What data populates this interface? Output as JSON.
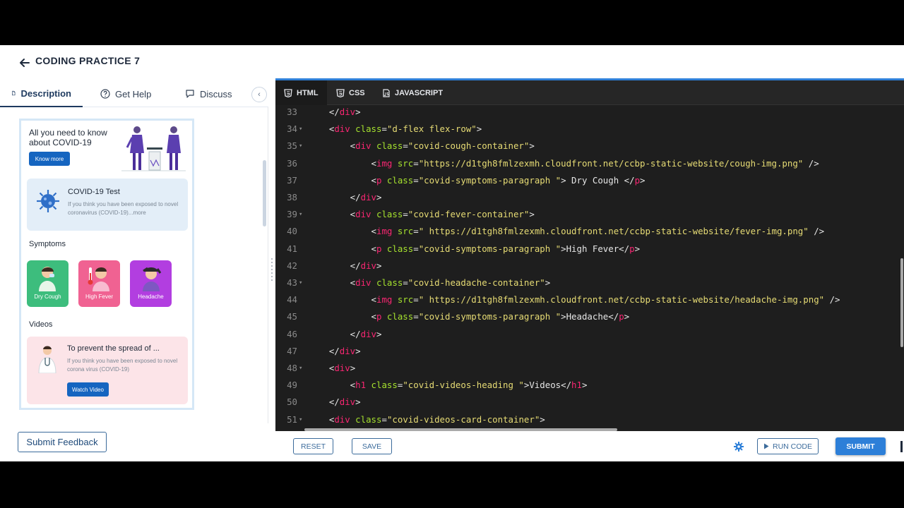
{
  "header": {
    "title": "CODING PRACTICE 7"
  },
  "left_tabs": [
    {
      "label": "Description",
      "icon": "document-icon"
    },
    {
      "label": "Get Help",
      "icon": "question-circle-icon"
    },
    {
      "label": "Discuss",
      "icon": "chat-icon"
    }
  ],
  "preview": {
    "hero_title": "All you need to know about COVID-19",
    "know_more": "Know more",
    "test_title": "COVID-19 Test",
    "test_desc": "If you think you have been exposed to novel coronavirus (COVID-19)...more",
    "symptoms_heading": "Symptoms",
    "symptoms": [
      "Dry Cough",
      "High Fever",
      "Headache"
    ],
    "videos_heading": "Videos",
    "video_title": "To prevent the spread of ...",
    "video_desc": "If you think you have been exposed to novel corona virus (COVID-19)",
    "watch_video": "Watch Video"
  },
  "feedback_label": "Submit Feedback",
  "editor_tabs": [
    {
      "label": "HTML",
      "icon": "html5-icon"
    },
    {
      "label": "CSS",
      "icon": "css3-icon"
    },
    {
      "label": "JAVASCRIPT",
      "icon": "js-file-icon"
    }
  ],
  "code_lines": [
    {
      "n": "33",
      "fold": false,
      "html": "    &lt;/<span class='tg'>div</span>&gt;"
    },
    {
      "n": "34",
      "fold": true,
      "html": "    &lt;<span class='tg'>div</span> <span class='at'>class</span>=<span class='st'>\"d-flex flex-row\"</span>&gt;"
    },
    {
      "n": "35",
      "fold": true,
      "html": "        &lt;<span class='tg'>div</span> <span class='at'>class</span>=<span class='st'>\"covid-cough-container\"</span>&gt;"
    },
    {
      "n": "36",
      "fold": false,
      "html": "            &lt;<span class='tg'>img</span> <span class='at'>src</span>=<span class='st'>\"https://d1tgh8fmlzexmh.cloudfront.net/ccbp-static-website/cough-img.png\"</span> /&gt;"
    },
    {
      "n": "37",
      "fold": false,
      "html": "            &lt;<span class='tg'>p</span> <span class='at'>class</span>=<span class='st'>\"covid-symptoms-paragraph \"</span>&gt; Dry Cough &lt;/<span class='tg'>p</span>&gt;"
    },
    {
      "n": "38",
      "fold": false,
      "html": "        &lt;/<span class='tg'>div</span>&gt;"
    },
    {
      "n": "39",
      "fold": true,
      "html": "        &lt;<span class='tg'>div</span> <span class='at'>class</span>=<span class='st'>\"covid-fever-container\"</span>&gt;"
    },
    {
      "n": "40",
      "fold": false,
      "html": "            &lt;<span class='tg'>img</span> <span class='at'>src</span>=<span class='st'>\" https://d1tgh8fmlzexmh.cloudfront.net/ccbp-static-website/fever-img.png\"</span> /&gt;"
    },
    {
      "n": "41",
      "fold": false,
      "html": "            &lt;<span class='tg'>p</span> <span class='at'>class</span>=<span class='st'>\"covid-symptoms-paragraph \"</span>&gt;High Fever&lt;/<span class='tg'>p</span>&gt;"
    },
    {
      "n": "42",
      "fold": false,
      "html": "        &lt;/<span class='tg'>div</span>&gt;"
    },
    {
      "n": "43",
      "fold": true,
      "html": "        &lt;<span class='tg'>div</span> <span class='at'>class</span>=<span class='st'>\"covid-headache-container\"</span>&gt;"
    },
    {
      "n": "44",
      "fold": false,
      "html": "            &lt;<span class='tg'>img</span> <span class='at'>src</span>=<span class='st'>\" https://d1tgh8fmlzexmh.cloudfront.net/ccbp-static-website/headache-img.png\"</span> /&gt;"
    },
    {
      "n": "45",
      "fold": false,
      "html": "            &lt;<span class='tg'>p</span> <span class='at'>class</span>=<span class='st'>\"covid-symptoms-paragraph \"</span>&gt;Headache&lt;/<span class='tg'>p</span>&gt;"
    },
    {
      "n": "46",
      "fold": false,
      "html": "        &lt;/<span class='tg'>div</span>&gt;"
    },
    {
      "n": "47",
      "fold": false,
      "html": "    &lt;/<span class='tg'>div</span>&gt;"
    },
    {
      "n": "48",
      "fold": true,
      "html": "    &lt;<span class='tg'>div</span>&gt;"
    },
    {
      "n": "49",
      "fold": false,
      "html": "        &lt;<span class='tg'>h1</span> <span class='at'>class</span>=<span class='st'>\"covid-videos-heading \"</span>&gt;Videos&lt;/<span class='tg'>h1</span>&gt;"
    },
    {
      "n": "50",
      "fold": false,
      "html": "    &lt;/<span class='tg'>div</span>&gt;"
    },
    {
      "n": "51",
      "fold": true,
      "html": "    &lt;<span class='tg'>div</span> <span class='at'>class</span>=<span class='st'>\"covid-videos-card-container\"</span>&gt;"
    }
  ],
  "bottom": {
    "reset": "RESET",
    "save": "SAVE",
    "run_code": "RUN CODE",
    "submit": "SUBMIT"
  },
  "colors": {
    "accent": "#2d7fd8",
    "editor_bg": "#1e1e1e",
    "dry_cough": "#3dbd7d",
    "high_fever": "#f06292",
    "headache": "#b23ee0"
  }
}
